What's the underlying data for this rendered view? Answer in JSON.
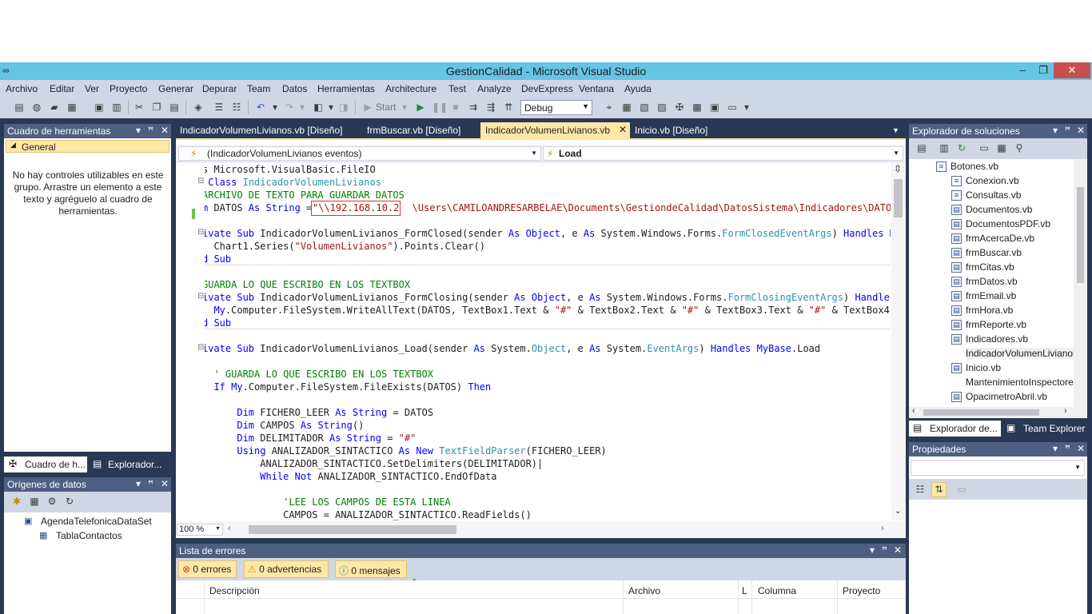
{
  "window": {
    "title": "GestionCalidad - Microsoft Visual Studio",
    "controls": {
      "minimize": "‒",
      "maximize": "❐",
      "close": "✕"
    }
  },
  "menu": [
    "Archivo",
    "Editar",
    "Ver",
    "Proyecto",
    "Generar",
    "Depurar",
    "Team",
    "Datos",
    "Herramientas",
    "Architecture",
    "Test",
    "Analyze",
    "DevExpress",
    "Ventana",
    "Ayuda"
  ],
  "toolbar": {
    "start_label": "Start",
    "config": "Debug"
  },
  "toolbox": {
    "title": "Cuadro de herramientas",
    "group": "General",
    "empty_message": "No hay controles utilizables en este grupo. Arrastre un elemento a este texto y agréguelo al cuadro de herramientas.",
    "tabs": [
      "Cuadro de h...",
      "Explorador..."
    ]
  },
  "datasources": {
    "title": "Orígenes de datos",
    "dataset": "AgendaTelefonicaDataSet",
    "table": "TablaContactos"
  },
  "editor": {
    "tabs": [
      {
        "label": "IndicadorVolumenLivianos.vb [Diseño]",
        "active": false
      },
      {
        "label": "frmBuscar.vb [Diseño]",
        "active": false
      },
      {
        "label": "IndicadorVolumenLivianos.vb",
        "active": true
      },
      {
        "label": "Inicio.vb [Diseño]",
        "active": false
      }
    ],
    "class_dropdown": "(IndicadorVolumenLivianos eventos)",
    "method_dropdown": "Load",
    "zoom": "100 %",
    "highlighted_text": "\"\\\\192.168.10.2"
  },
  "solution_explorer": {
    "title": "Explorador de soluciones",
    "files": [
      "Botones.vb",
      "Conexion.vb",
      "Consultas.vb",
      "Documentos.vb",
      "DocumentosPDF.vb",
      "frmAcercaDe.vb",
      "frmBuscar.vb",
      "frmCitas.vb",
      "frmDatos.vb",
      "frmEmail.vb",
      "frmHora.vb",
      "frmReporte.vb",
      "Indicadores.vb",
      "IndicadorVolumenLivianos",
      "Inicio.vb",
      "MantenimientoInspectore",
      "OpacimetroAbril.vb"
    ],
    "tabs": [
      "Explorador de...",
      "Team Explorer"
    ]
  },
  "properties": {
    "title": "Propiedades"
  },
  "error_list": {
    "title": "Lista de errores",
    "errors": "0 errores",
    "warnings": "0 advertencias",
    "messages": "0 mensajes",
    "columns": [
      "Descripción",
      "Archivo",
      "L",
      "Columna",
      "Proyecto"
    ]
  }
}
